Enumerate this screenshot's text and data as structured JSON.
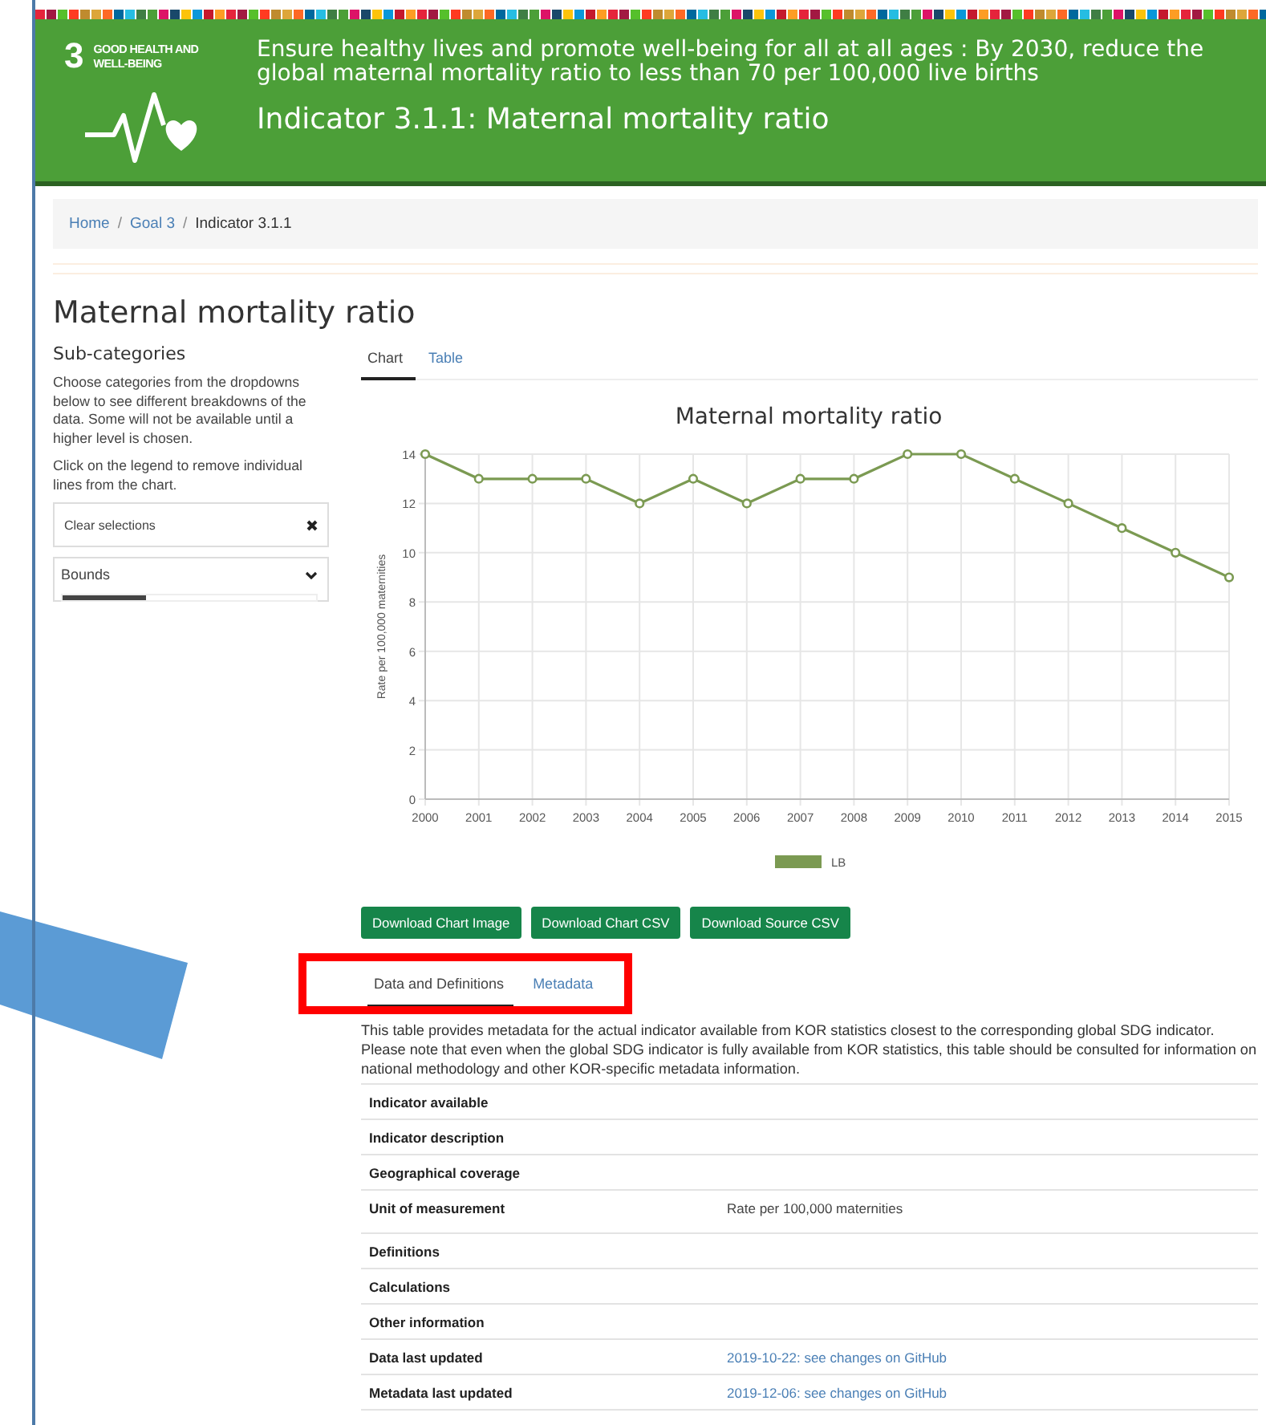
{
  "header": {
    "goal_number": "3",
    "goal_name": "GOOD HEALTH AND WELL-BEING",
    "target": "Ensure healthy lives and promote well-being for all at all ages : By 2030, reduce the global maternal mortality ratio to less than 70 per 100,000 live births",
    "indicator": "Indicator 3.1.1: Maternal mortality ratio"
  },
  "breadcrumb_separator": "/",
  "breadcrumb": [
    {
      "label": "Home",
      "kind": "link"
    },
    {
      "label": "Goal 3",
      "kind": "link"
    },
    {
      "label": "Indicator 3.1.1",
      "kind": "current"
    }
  ],
  "page_title": "Maternal mortality ratio",
  "sidebar": {
    "heading": "Sub-categories",
    "paragraphs": [
      "Choose categories from the dropdowns below to see different breakdowns of the data. Some will not be available until a higher level is chosen.",
      "Click on the legend to remove individual lines from the chart."
    ],
    "clear_label": "Clear selections",
    "dropdown": {
      "label": "Bounds",
      "level": 0.33
    }
  },
  "view_tabs": [
    {
      "label": "Chart",
      "selected": true
    },
    {
      "label": "Table",
      "selected": false
    }
  ],
  "chart": {
    "chart_data": {
      "type": "line",
      "title": "Maternal mortality ratio",
      "ylabel": "Rate per 100,000 maternities",
      "categories": [
        "2000",
        "2001",
        "2002",
        "2003",
        "2004",
        "2005",
        "2006",
        "2007",
        "2008",
        "2009",
        "2010",
        "2011",
        "2012",
        "2013",
        "2014",
        "2015"
      ],
      "series": [
        {
          "name": "LB",
          "color": "#7b9a52",
          "marker": "circle",
          "values": [
            14,
            13,
            13,
            13,
            12,
            13,
            12,
            13,
            13,
            14,
            14,
            13,
            12,
            11,
            10,
            9
          ]
        }
      ],
      "grid": true,
      "ylim": [
        0,
        14
      ],
      "yticks": [
        0,
        2,
        4,
        6,
        8,
        10,
        12,
        14
      ]
    }
  },
  "buttons": [
    "Download Chart Image",
    "Download Chart CSV",
    "Download Source CSV"
  ],
  "info_tabs": [
    {
      "label": "Data and Definitions",
      "selected": true
    },
    {
      "label": "Metadata",
      "selected": false
    }
  ],
  "intro": "This table provides metadata for the actual indicator available from KOR statistics closest to the corresponding global SDG indicator. Please note that even when the global SDG indicator is fully available from KOR statistics, this table should be consulted for information on national methodology and other KOR-specific metadata information.",
  "metadata_rows": [
    {
      "label": "Indicator available"
    },
    {
      "label": "Indicator description"
    },
    {
      "label": "Geographical coverage"
    },
    {
      "label": "Unit of measurement",
      "value": "Rate per 100,000 maternities",
      "kind": "text"
    },
    {
      "label": "Definitions"
    },
    {
      "label": "Calculations"
    },
    {
      "label": "Other information"
    },
    {
      "label": "Data last updated",
      "value": "2019-10-22: see changes on GitHub",
      "kind": "link"
    },
    {
      "label": "Metadata last updated",
      "value": "2019-12-06: see changes on GitHub",
      "kind": "link"
    }
  ]
}
